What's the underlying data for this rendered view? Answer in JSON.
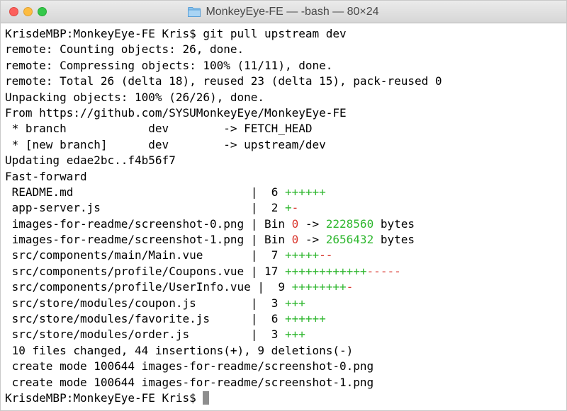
{
  "window": {
    "title": "MonkeyEye-FE — -bash — 80×24"
  },
  "icons": {
    "title_icon": "folder-icon",
    "close": "close-button",
    "minimize": "minimize-button",
    "maximize": "maximize-button"
  },
  "colors": {
    "insertion": "#2fb72f",
    "deletion": "#d9372e",
    "cursor": "#8e8e8e"
  },
  "terminal": {
    "prompt_line": "KrisdeMBP:MonkeyEye-FE Kris$ git pull upstream dev",
    "lines": [
      "remote: Counting objects: 26, done.",
      "remote: Compressing objects: 100% (11/11), done.",
      "remote: Total 26 (delta 18), reused 23 (delta 15), pack-reused 0",
      "Unpacking objects: 100% (26/26), done.",
      "From https://github.com/SYSUMonkeyEye/MonkeyEye-FE",
      " * branch            dev        -> FETCH_HEAD",
      " * [new branch]      dev        -> upstream/dev",
      "Updating edae2bc..f4b56f7",
      "Fast-forward"
    ],
    "diffstat": [
      {
        "path": " README.md                          ",
        "sep": "|",
        "count": "  6 ",
        "plus": "++++++",
        "minus": ""
      },
      {
        "path": " app-server.js                      ",
        "sep": "|",
        "count": "  2 ",
        "plus": "+",
        "minus": "-"
      },
      {
        "path": " images-for-readme/screenshot-0.png ",
        "sep": "|",
        "count": " Bin ",
        "bin_old": "0",
        "bin_arrow": " -> ",
        "bin_new": "2228560",
        "bin_unit": " bytes"
      },
      {
        "path": " images-for-readme/screenshot-1.png ",
        "sep": "|",
        "count": " Bin ",
        "bin_old": "0",
        "bin_arrow": " -> ",
        "bin_new": "2656432",
        "bin_unit": " bytes"
      },
      {
        "path": " src/components/main/Main.vue       ",
        "sep": "|",
        "count": "  7 ",
        "plus": "+++++",
        "minus": "--"
      },
      {
        "path": " src/components/profile/Coupons.vue ",
        "sep": "|",
        "count": " 17 ",
        "plus": "++++++++++++",
        "minus": "-----"
      },
      {
        "path": " src/components/profile/UserInfo.vue",
        "sep": " |",
        "count": "  9 ",
        "plus": "++++++++",
        "minus": "-"
      },
      {
        "path": " src/store/modules/coupon.js        ",
        "sep": "|",
        "count": "  3 ",
        "plus": "+++",
        "minus": ""
      },
      {
        "path": " src/store/modules/favorite.js      ",
        "sep": "|",
        "count": "  6 ",
        "plus": "++++++",
        "minus": ""
      },
      {
        "path": " src/store/modules/order.js         ",
        "sep": "|",
        "count": "  3 ",
        "plus": "+++",
        "minus": ""
      }
    ],
    "summary_lines": [
      " 10 files changed, 44 insertions(+), 9 deletions(-)",
      " create mode 100644 images-for-readme/screenshot-0.png",
      " create mode 100644 images-for-readme/screenshot-1.png"
    ],
    "final_prompt": "KrisdeMBP:MonkeyEye-FE Kris$ "
  }
}
